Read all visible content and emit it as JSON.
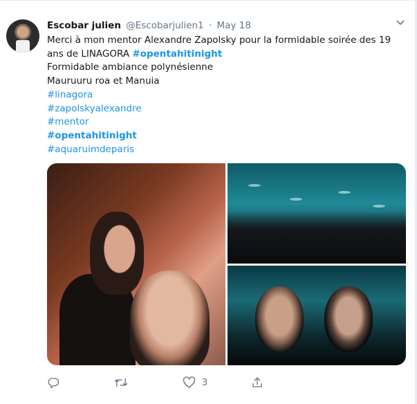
{
  "tweet": {
    "author_name": "Escobar julien",
    "handle": "@Escobarjulien1",
    "separator": "·",
    "date": "May 18",
    "lines": [
      {
        "text": "Merci à mon mentor Alexandre Zapolsky pour la formidable soirée des 19",
        "tag": "",
        "bold": false
      },
      {
        "text": "ans de LINAGORA ",
        "tag": "#opentahitinight",
        "bold": true
      },
      {
        "text": "Formidable ambiance polynésienne",
        "tag": "",
        "bold": false
      },
      {
        "text": "Mauruuru roa et Manuia",
        "tag": "",
        "bold": false
      }
    ],
    "hashtags": [
      {
        "text": "#linagora",
        "bold": false
      },
      {
        "text": "#zapolskyalexandre",
        "bold": false
      },
      {
        "text": "#mentor",
        "bold": false
      },
      {
        "text": "#opentahitinight",
        "bold": true
      },
      {
        "text": "#aquaruimdeparis",
        "bold": false
      }
    ],
    "like_count": "3"
  },
  "icons": {
    "caret": "chevron-down-icon",
    "reply": "reply-icon",
    "retweet": "retweet-icon",
    "like": "heart-icon",
    "share": "share-icon"
  },
  "colors": {
    "link": "#1b95e0",
    "text": "#14171a",
    "muted": "#657786"
  }
}
